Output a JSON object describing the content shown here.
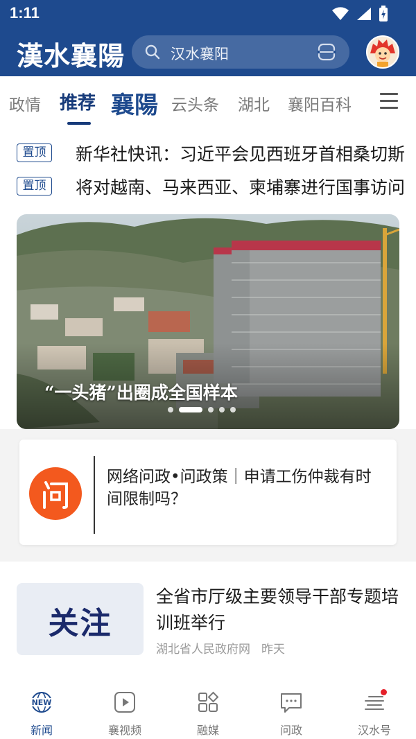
{
  "status": {
    "time": "1:11"
  },
  "header": {
    "logo": "漢水襄陽",
    "search_placeholder": "汉水襄阳"
  },
  "tabs": {
    "items": [
      "政情",
      "推荐",
      "襄陽",
      "云头条",
      "湖北",
      "襄阳百科"
    ],
    "active_index": 1
  },
  "pinned": [
    {
      "badge": "置顶",
      "text": "新华社快讯：习近平会见西班牙首相桑切斯"
    },
    {
      "badge": "置顶",
      "text": "将对越南、马来西亚、柬埔寨进行国事访问"
    }
  ],
  "carousel": {
    "caption": "“一头猪”出圈成全国样本",
    "slide_count": 5,
    "active_slide": 1
  },
  "card": {
    "icon_char": "问",
    "text": "网络问政•问政策｜申请工伤仲裁有时间限制吗？"
  },
  "news": {
    "thumb_text": "关注",
    "title": "全省市厅级主要领导干部专题培训班举行",
    "source": "湖北省人民政府网",
    "time": "昨天"
  },
  "bottom_nav": [
    {
      "label": "新闻",
      "icon": "news-globe-icon",
      "active": true
    },
    {
      "label": "襄视频",
      "icon": "play-video-icon",
      "active": false
    },
    {
      "label": "融媒",
      "icon": "grid-apps-icon",
      "active": false
    },
    {
      "label": "问政",
      "icon": "chat-bubble-icon",
      "active": false
    },
    {
      "label": "汉水号",
      "icon": "feed-lines-icon",
      "active": false
    }
  ],
  "colors": {
    "brand_blue": "#1e4a8e",
    "accent_red": "#e5202a",
    "ask_orange": "#f3591e"
  }
}
